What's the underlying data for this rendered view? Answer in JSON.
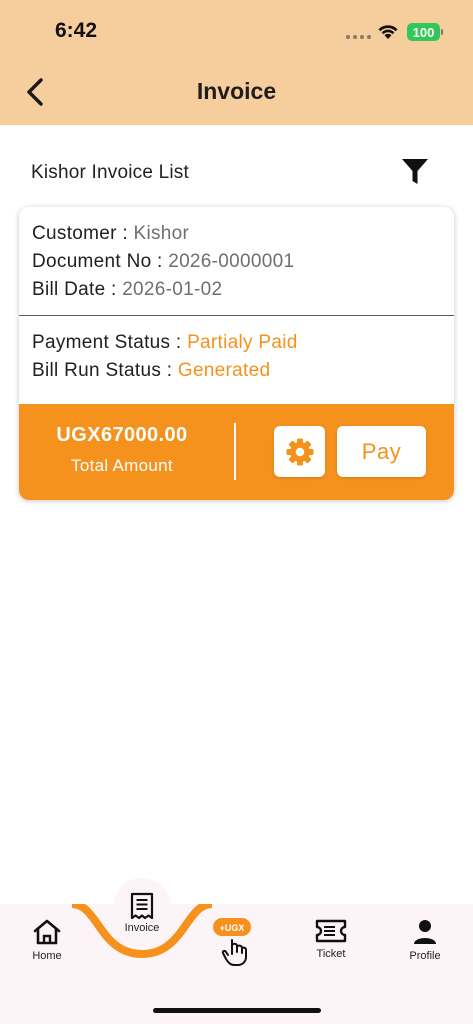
{
  "status_bar": {
    "time": "6:42",
    "battery": "100",
    "wifi_icon": "wifi-icon",
    "signal_icon": "signal-dots-icon"
  },
  "header": {
    "title": "Invoice",
    "back_icon": "chevron-left-icon",
    "background": "#f6cd9c"
  },
  "list": {
    "title": "Kishor Invoice List",
    "filter_icon": "filter-icon"
  },
  "invoice": {
    "customer_label": "Customer : ",
    "customer_value": "Kishor",
    "document_label": "Document No : ",
    "document_value": "2026-0000001",
    "bill_date_label": "Bill Date : ",
    "bill_date_value": "2026-01-02",
    "payment_status_label": "Payment Status : ",
    "payment_status_value": "Partialy Paid",
    "bill_run_status_label": "Bill Run Status : ",
    "bill_run_status_value": "Generated",
    "amount": "UGX67000.00",
    "amount_label": "Total Amount",
    "settings_icon": "gear-icon",
    "pay_label": "Pay"
  },
  "bottom_nav": {
    "items": [
      {
        "label": "Home",
        "icon": "home-icon"
      },
      {
        "label": "Invoice",
        "icon": "receipt-icon",
        "active": true
      },
      {
        "label": "",
        "icon": "pay-ugx-icon",
        "badge": "+UGX"
      },
      {
        "label": "Ticket",
        "icon": "ticket-icon"
      },
      {
        "label": "Profile",
        "icon": "profile-icon"
      }
    ]
  },
  "colors": {
    "accent": "#f5921e",
    "header_bg": "#f6cd9c",
    "nav_bg": "#fdf4f8"
  }
}
